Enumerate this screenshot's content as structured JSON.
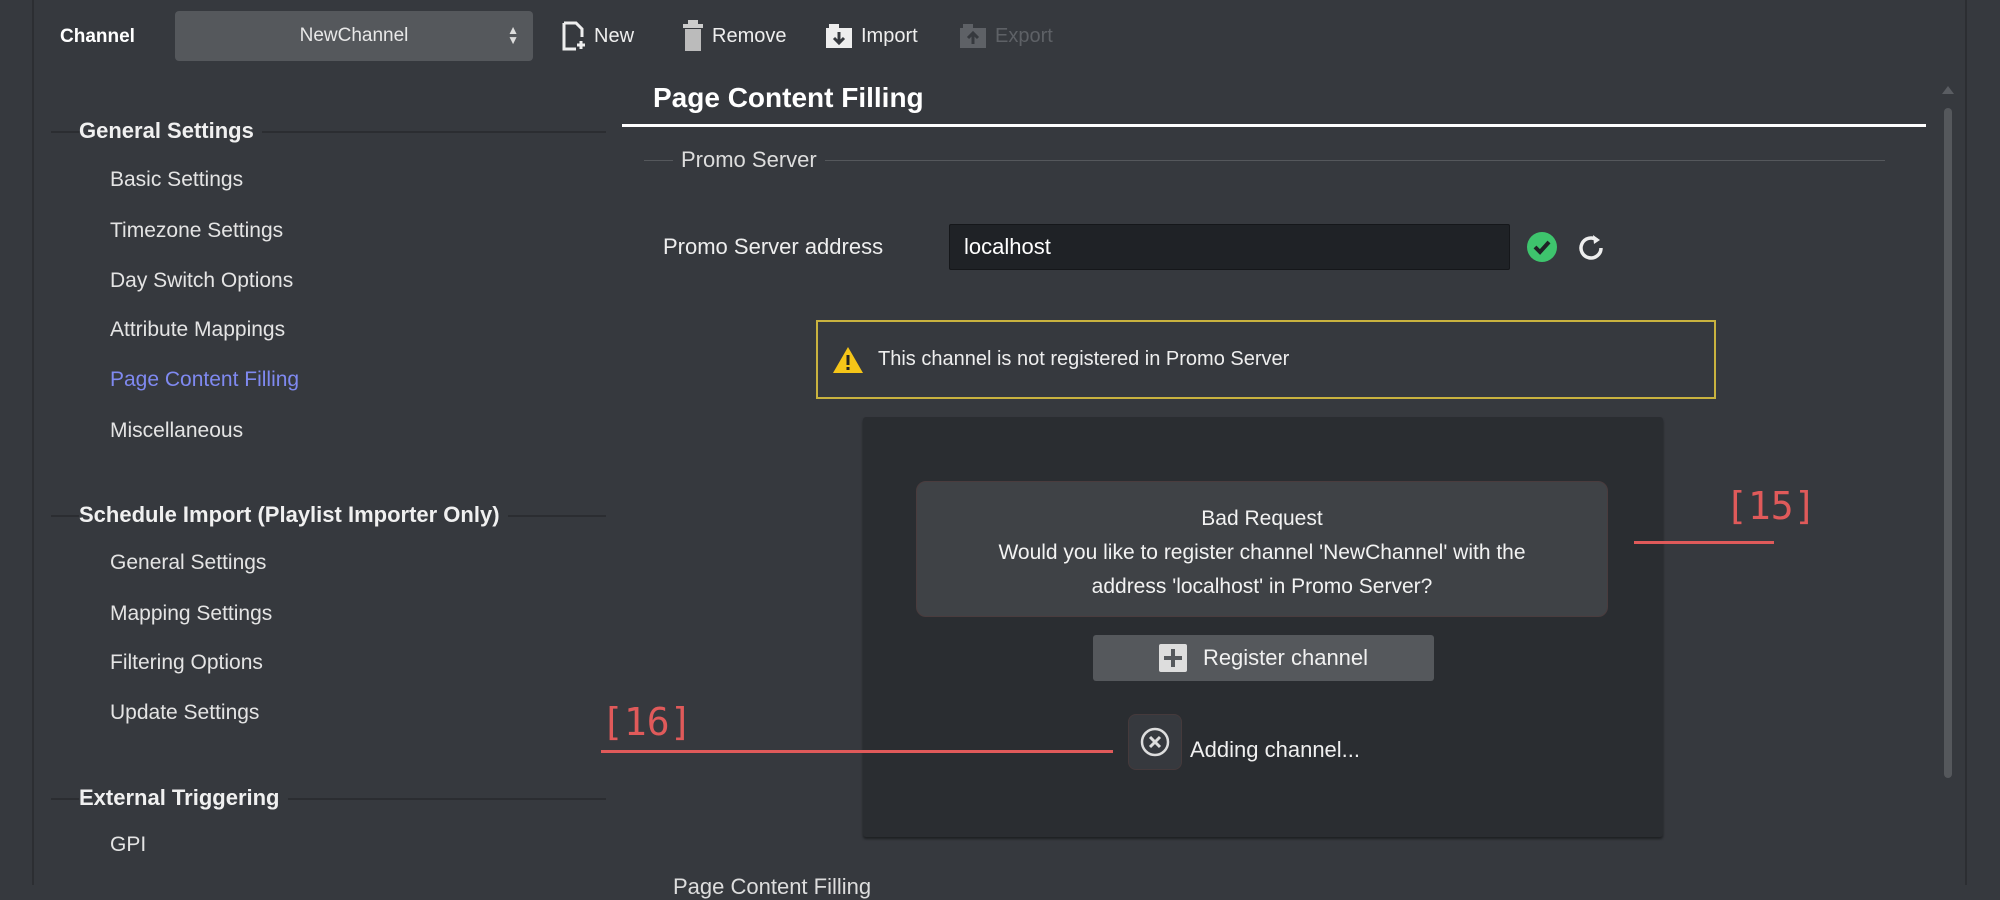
{
  "toolbar": {
    "channel_label": "Channel",
    "channel_value": "NewChannel",
    "new": "New",
    "remove": "Remove",
    "import": "Import",
    "export": "Export"
  },
  "sidebar": {
    "sections": [
      {
        "title": "General Settings",
        "items": [
          "Basic Settings",
          "Timezone Settings",
          "Day Switch Options",
          "Attribute Mappings",
          "Page Content Filling",
          "Miscellaneous"
        ]
      },
      {
        "title": "Schedule Import (Playlist Importer Only)",
        "items": [
          "General Settings",
          "Mapping Settings",
          "Filtering Options",
          "Update Settings"
        ]
      },
      {
        "title": "External Triggering",
        "items": [
          "GPI"
        ]
      }
    ],
    "active": "Page Content Filling"
  },
  "main": {
    "title": "Page Content Filling",
    "group": "Promo Server",
    "address_label": "Promo Server address",
    "address_value": "localhost",
    "warning": "This channel is not registered in Promo Server",
    "message_title": "Bad Request",
    "message_line1": "Would you like to register channel 'NewChannel' with the",
    "message_line2": "address 'localhost' in Promo Server?",
    "register_button": "Register channel",
    "status": "Adding channel...",
    "next_group": "Page Content Filling"
  },
  "annotations": {
    "a15": "[15]",
    "a16": "[16]"
  },
  "colors": {
    "accent": "#7f89f0",
    "warning": "#c9b33f",
    "ok": "#3ec46d",
    "annotation": "#e05a5a"
  }
}
